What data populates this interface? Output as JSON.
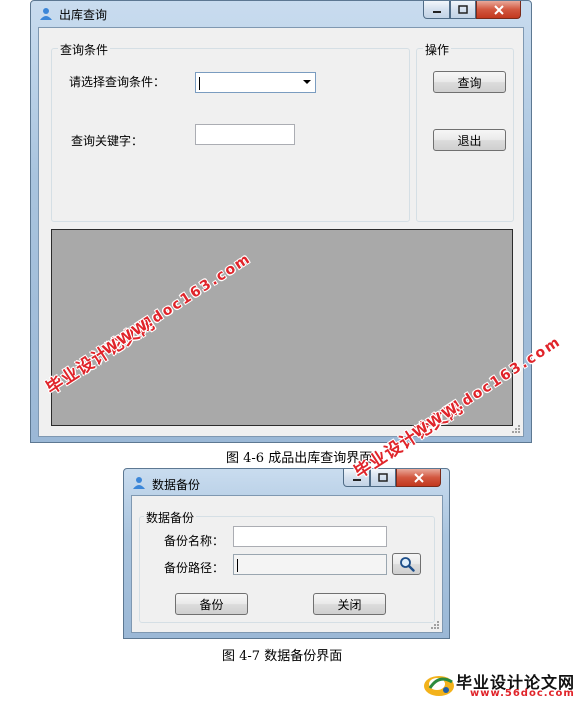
{
  "window1": {
    "title": "出库查询",
    "group_query": "查询条件",
    "label_condition": "请选择查询条件：",
    "condition_value": "",
    "label_keyword": "查询关键字：",
    "keyword_value": "",
    "group_operation": "操作",
    "btn_query": "查询",
    "btn_exit": "退出"
  },
  "caption1": "图 4-6  成品出库查询界面",
  "window2": {
    "title": "数据备份",
    "group_backup": "数据备份",
    "label_name": "备份名称：",
    "name_value": "",
    "label_path": "备份路径：",
    "path_value": "",
    "btn_backup": "备份",
    "btn_close": "关闭"
  },
  "caption2": "图 4-7  数据备份界面",
  "watermarks": {
    "site_cn": "毕业设计论文网",
    "site_url": "WWW.doc163.com",
    "logo_cn": "毕业设计论文网",
    "logo_url": "www.56doc.com"
  },
  "colors": {
    "watermark": "#e0242a",
    "close_button": "#c2381f",
    "title_gradient": "#a9c4de",
    "grid_background": "#a9a9a9"
  }
}
